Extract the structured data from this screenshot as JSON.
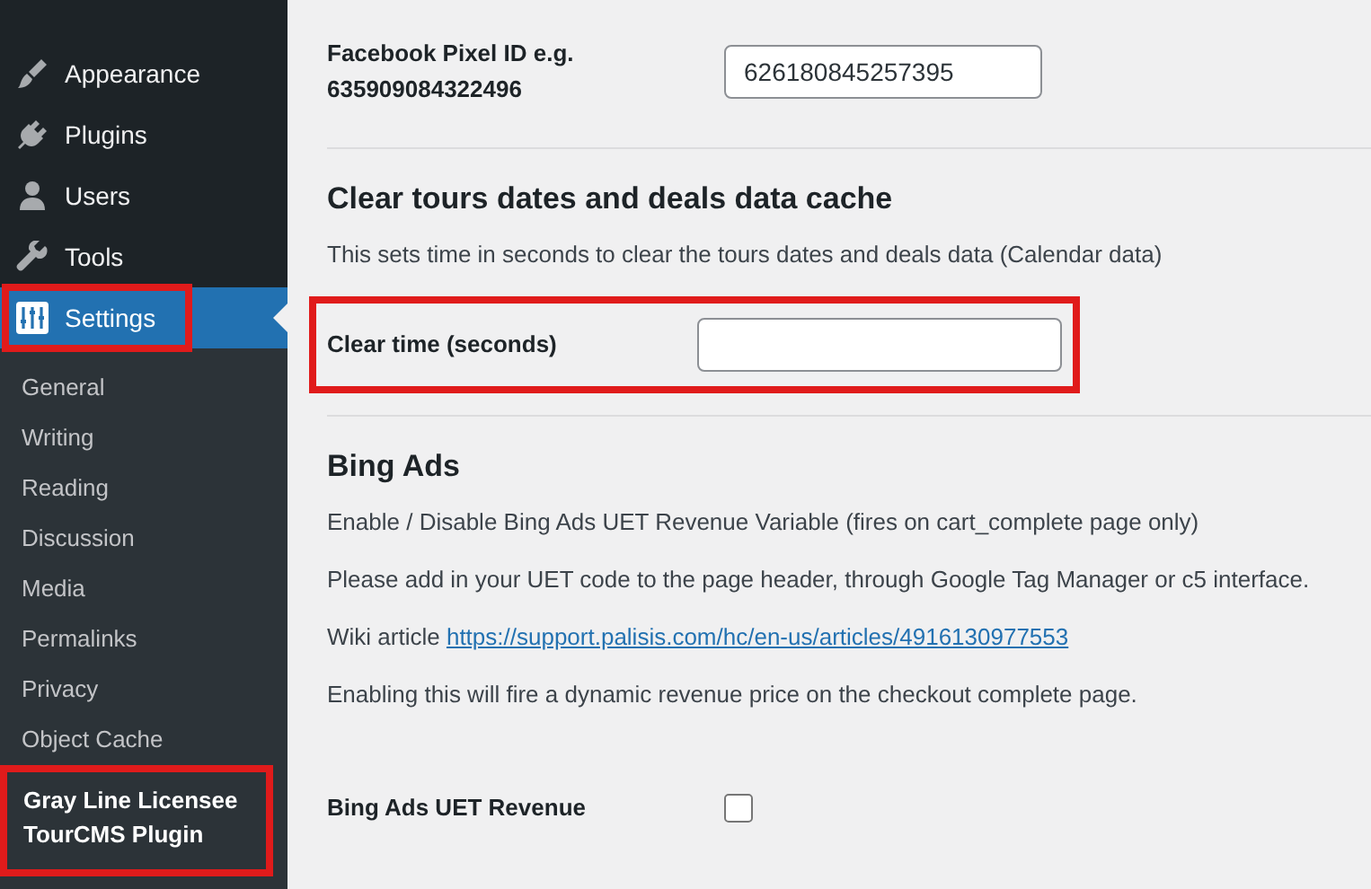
{
  "sidebar": {
    "menu": [
      {
        "label": "Appearance",
        "kind": "brush",
        "selected": false,
        "highlighted": false
      },
      {
        "label": "Plugins",
        "kind": "plug",
        "selected": false,
        "highlighted": false
      },
      {
        "label": "Users",
        "kind": "user",
        "selected": false,
        "highlighted": false
      },
      {
        "label": "Tools",
        "kind": "wrench",
        "selected": false,
        "highlighted": false
      },
      {
        "label": "Settings",
        "kind": "sliders",
        "selected": true,
        "highlighted": true
      }
    ],
    "submenu": [
      {
        "label": "General",
        "selected": false,
        "highlighted": false
      },
      {
        "label": "Writing",
        "selected": false,
        "highlighted": false
      },
      {
        "label": "Reading",
        "selected": false,
        "highlighted": false
      },
      {
        "label": "Discussion",
        "selected": false,
        "highlighted": false
      },
      {
        "label": "Media",
        "selected": false,
        "highlighted": false
      },
      {
        "label": "Permalinks",
        "selected": false,
        "highlighted": false
      },
      {
        "label": "Privacy",
        "selected": false,
        "highlighted": false
      },
      {
        "label": "Object Cache",
        "selected": false,
        "highlighted": false
      },
      {
        "label": "Gray Line Licensee TourCMS Plugin",
        "selected": true,
        "highlighted": true
      }
    ]
  },
  "sections": [
    {
      "rows": [
        {
          "kind": "text",
          "label": "Facebook Pixel ID e.g. 635909084322496",
          "value": "626180845257395",
          "highlighted": false
        }
      ]
    },
    {
      "heading": "Clear tours dates and deals data cache",
      "paragraphs": [
        {
          "text": "This sets time in seconds to clear the tours dates and deals data (Calendar data)"
        }
      ],
      "rows": [
        {
          "kind": "text",
          "label": "Clear time (seconds)",
          "value": "",
          "highlighted": true
        }
      ]
    },
    {
      "heading": "Bing Ads",
      "paragraphs": [
        {
          "text": "Enable / Disable Bing Ads UET Revenue Variable (fires on cart_complete page only)"
        },
        {
          "text": "Please add in your UET code to the page header, through Google Tag Manager or c5 interface."
        },
        {
          "text": "Wiki article",
          "link": "https://support.palisis.com/hc/en-us/articles/4916130977553"
        },
        {
          "text": "Enabling this will fire a dynamic revenue price on the checkout complete page."
        }
      ],
      "rows": [
        {
          "kind": "checkbox",
          "label": "Bing Ads UET Revenue",
          "checked": false,
          "highlighted": false
        }
      ]
    }
  ]
}
